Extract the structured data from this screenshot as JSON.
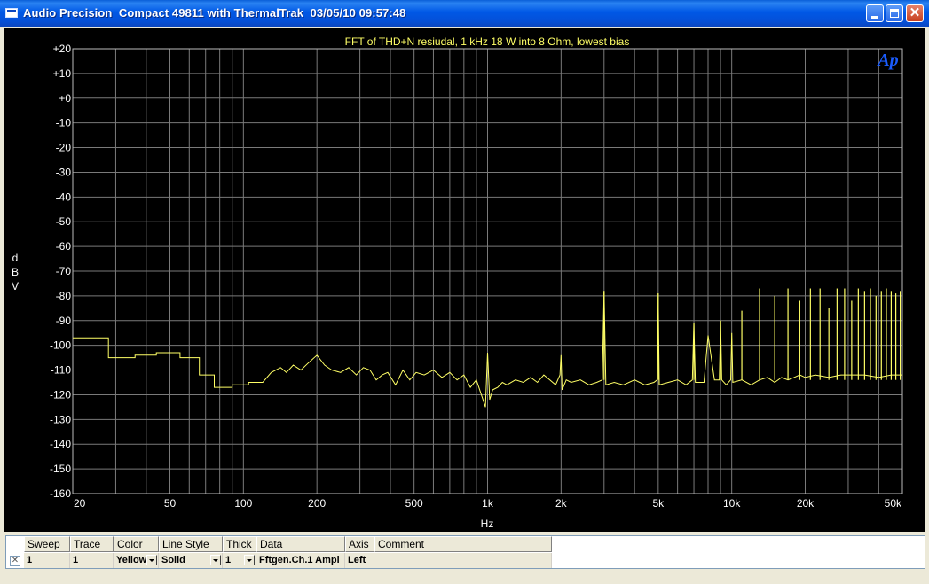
{
  "window": {
    "title": "Audio Precision  Compact 49811 with ThermalTrak  03/05/10 09:57:48",
    "buttons": {
      "minimize": "minimize-icon",
      "maximize": "maximize-icon",
      "close": "close-icon"
    }
  },
  "colors": {
    "trace": "#ffff66",
    "grid": "#7a7a7a",
    "title": "#ffff66",
    "text": "#ffffff",
    "logo": "#1a5cff"
  },
  "logo": {
    "text": "Ap"
  },
  "chart_data": {
    "type": "line",
    "title": "FFT of THD+N resiudal, 1 kHz 18 W into 8 Ohm, lowest bias",
    "xlabel": "Hz",
    "ylabel": "dBV",
    "xscale": "log",
    "xlim": [
      20,
      50000
    ],
    "ylim": [
      -160,
      20
    ],
    "grid": true,
    "xticks": [
      {
        "v": 20,
        "label": "20"
      },
      {
        "v": 50,
        "label": "50"
      },
      {
        "v": 100,
        "label": "100"
      },
      {
        "v": 200,
        "label": "200"
      },
      {
        "v": 500,
        "label": "500"
      },
      {
        "v": 1000,
        "label": "1k"
      },
      {
        "v": 2000,
        "label": "2k"
      },
      {
        "v": 5000,
        "label": "5k"
      },
      {
        "v": 10000,
        "label": "10k"
      },
      {
        "v": 20000,
        "label": "20k"
      },
      {
        "v": 50000,
        "label": "50k"
      }
    ],
    "yticks": [
      {
        "v": 20,
        "label": "+20"
      },
      {
        "v": 10,
        "label": "+10"
      },
      {
        "v": 0,
        "label": "+0"
      },
      {
        "v": -10,
        "label": "-10"
      },
      {
        "v": -20,
        "label": "-20"
      },
      {
        "v": -30,
        "label": "-30"
      },
      {
        "v": -40,
        "label": "-40"
      },
      {
        "v": -50,
        "label": "-50"
      },
      {
        "v": -60,
        "label": "-60"
      },
      {
        "v": -70,
        "label": "-70"
      },
      {
        "v": -80,
        "label": "-80"
      },
      {
        "v": -90,
        "label": "-90"
      },
      {
        "v": -100,
        "label": "-100"
      },
      {
        "v": -110,
        "label": "-110"
      },
      {
        "v": -120,
        "label": "-120"
      },
      {
        "v": -130,
        "label": "-130"
      },
      {
        "v": -140,
        "label": "-140"
      },
      {
        "v": -150,
        "label": "-150"
      },
      {
        "v": -160,
        "label": "-160"
      }
    ],
    "series": [
      {
        "x": [
          20,
          28,
          28,
          36,
          36,
          44,
          44,
          55,
          55,
          66,
          66,
          76,
          76,
          90,
          90,
          105,
          105,
          120,
          130,
          142,
          150,
          160,
          172,
          185,
          200,
          215,
          230,
          250,
          270,
          290,
          310,
          330,
          350,
          370,
          390,
          420,
          450,
          480,
          510,
          550,
          600,
          650,
          700,
          750,
          800,
          850,
          900,
          950,
          980,
          1000,
          1020,
          1050,
          1100,
          1150,
          1200,
          1300,
          1400,
          1500,
          1600,
          1700,
          1800,
          1900,
          1980,
          2000,
          2020,
          2100,
          2200,
          2400,
          2600,
          2800,
          2950,
          3000,
          3050,
          3300,
          3600,
          4000,
          4400,
          4800,
          4950,
          5000,
          5050,
          5500,
          6000,
          6500,
          6900,
          7000,
          7100,
          7700,
          8000,
          8500,
          8900,
          9000,
          9100,
          9500,
          9900,
          10000,
          10100,
          11000,
          12000,
          13000,
          14000,
          15000,
          16000,
          17000,
          18000,
          19000,
          20000,
          22000,
          25000,
          28000,
          30000,
          35000,
          40000,
          45000,
          50000
        ],
        "values": [
          -97,
          -97,
          -105,
          -105,
          -104,
          -104,
          -103,
          -103,
          -105,
          -105,
          -112,
          -112,
          -117,
          -117,
          -116,
          -116,
          -115,
          -115,
          -111,
          -109,
          -111,
          -108,
          -110,
          -107,
          -104,
          -108,
          -110,
          -111,
          -109,
          -112,
          -109,
          -110,
          -114,
          -112,
          -111,
          -116,
          -110,
          -114,
          -111,
          -112,
          -110,
          -113,
          -111,
          -114,
          -112,
          -117,
          -114,
          -121,
          -125,
          -103,
          -122,
          -118,
          -117,
          -115,
          -116,
          -114,
          -115,
          -113,
          -115,
          -112,
          -114,
          -116,
          -112,
          -104,
          -118,
          -114,
          -115,
          -114,
          -116,
          -115,
          -114,
          -78,
          -116,
          -115,
          -116,
          -114,
          -116,
          -115,
          -114,
          -79,
          -116,
          -115,
          -114,
          -116,
          -114,
          -91,
          -115,
          -115,
          -96,
          -114,
          -114,
          -90,
          -114,
          -116,
          -114,
          -95,
          -115,
          -114,
          -116,
          -114,
          -113,
          -115,
          -113,
          -114,
          -113,
          -112,
          -113,
          -112,
          -113,
          -112,
          -112,
          -112,
          -113,
          -112,
          -112
        ],
        "spikes": [
          {
            "x": 3000,
            "y": -78
          },
          {
            "x": 5000,
            "y": -79
          },
          {
            "x": 7000,
            "y": -91
          },
          {
            "x": 9000,
            "y": -90
          },
          {
            "x": 11000,
            "y": -86
          },
          {
            "x": 13000,
            "y": -77
          },
          {
            "x": 15000,
            "y": -80
          },
          {
            "x": 17000,
            "y": -77
          },
          {
            "x": 19000,
            "y": -82
          },
          {
            "x": 21000,
            "y": -77
          },
          {
            "x": 23000,
            "y": -77
          },
          {
            "x": 25000,
            "y": -85
          },
          {
            "x": 27000,
            "y": -77
          },
          {
            "x": 29000,
            "y": -77
          },
          {
            "x": 31000,
            "y": -82
          },
          {
            "x": 33000,
            "y": -77
          },
          {
            "x": 35000,
            "y": -78
          },
          {
            "x": 37000,
            "y": -77
          },
          {
            "x": 39000,
            "y": -80
          },
          {
            "x": 41000,
            "y": -78
          },
          {
            "x": 43000,
            "y": -77
          },
          {
            "x": 45000,
            "y": -78
          },
          {
            "x": 47000,
            "y": -79
          },
          {
            "x": 49000,
            "y": -78
          }
        ]
      }
    ]
  },
  "legend_table": {
    "headers": [
      "Sweep",
      "Trace",
      "Color",
      "Line Style",
      "Thick",
      "Data",
      "Axis",
      "Comment"
    ],
    "row": {
      "sweep": "1",
      "trace": "1",
      "color": "Yellow",
      "line_style": "Solid",
      "thick": "1",
      "data": "Fftgen.Ch.1 Ampl",
      "axis": "Left",
      "comment": ""
    }
  }
}
